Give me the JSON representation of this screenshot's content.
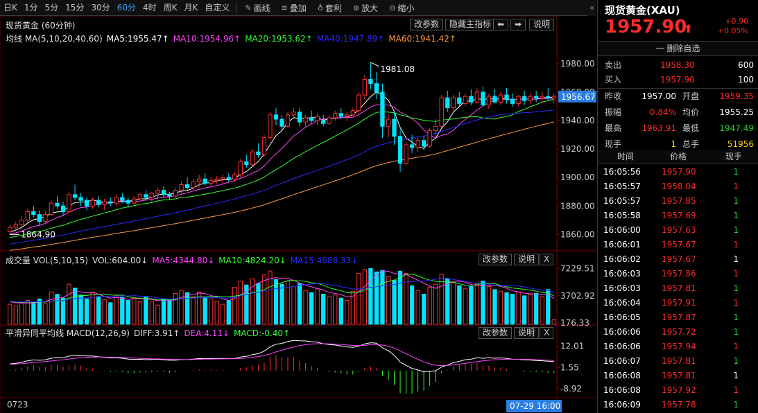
{
  "toolbar": {
    "periods": [
      "日K",
      "1分",
      "5分",
      "15分",
      "30分",
      "60分",
      "4时",
      "周K",
      "月K",
      "自定义"
    ],
    "active_period": "60分",
    "tools": [
      {
        "icon": "pencil-icon",
        "label": "画线"
      },
      {
        "icon": "layers-icon",
        "label": "叠加"
      },
      {
        "icon": "money-bag-icon",
        "label": "套利"
      },
      {
        "icon": "zoom-in-icon",
        "label": "放大"
      },
      {
        "icon": "zoom-out-icon",
        "label": "缩小"
      }
    ],
    "collapse": "«"
  },
  "main_panel": {
    "title": "现货黄金 (60分钟)",
    "buttons": {
      "params": "改参数",
      "hide": "隐藏主指标",
      "left": "⬅",
      "right": "➡",
      "explain": "说明"
    },
    "ma_legend": [
      {
        "text": "均线 MA(5,10,20,40,60)",
        "color": "#e0e0e0"
      },
      {
        "text": "MA5:1955.47↑",
        "color": "#ffffff"
      },
      {
        "text": "MA10:1954.96↑",
        "color": "#ff44ff"
      },
      {
        "text": "MA20:1953.62↑",
        "color": "#33ff33"
      },
      {
        "text": "MA40:1947.89↑",
        "color": "#2a2aff"
      },
      {
        "text": "MA60:1941.42↑",
        "color": "#ff9a3c"
      }
    ],
    "annot_high": "1981.08",
    "annot_low": "1864.90",
    "current_tag": "1956.67"
  },
  "vol_panel": {
    "legend": [
      {
        "text": "成交量 VOL(5,10,15)",
        "color": "#e0e0e0"
      },
      {
        "text": "VOL:604.00↓",
        "color": "#e0e0e0"
      },
      {
        "text": "MA5:4344.80↓",
        "color": "#ff44ff"
      },
      {
        "text": "MA10:4824.20↓",
        "color": "#33ff33"
      },
      {
        "text": "MA15:4688.33↓",
        "color": "#2a2aff"
      }
    ],
    "buttons": {
      "params": "改参数",
      "explain": "说明",
      "close": "X"
    }
  },
  "macd_panel": {
    "legend": [
      {
        "text": "平滑异同平均线 MACD(12,26,9)",
        "color": "#e0e0e0"
      },
      {
        "text": "DIFF:3.91↑",
        "color": "#e0e0e0"
      },
      {
        "text": "DEA:4.11↓",
        "color": "#ff44ff"
      },
      {
        "text": "MACD:-0.40↑",
        "color": "#33ff33"
      }
    ],
    "buttons": {
      "params": "改参数",
      "explain": "说明",
      "close": "X"
    }
  },
  "xaxis": {
    "left_label": "0723",
    "right_label": "07-29 16:00"
  },
  "chart_data": {
    "type": "candlestick",
    "price_axis": {
      "ticks": [
        1980,
        1960,
        1940,
        1920,
        1900,
        1880,
        1860
      ],
      "range": [
        1848,
        1996
      ]
    },
    "vol_axis": {
      "ticks": [
        7229.51,
        3702.92,
        176.33
      ],
      "range": [
        0,
        8000
      ]
    },
    "macd_axis": {
      "ticks": [
        12.01,
        1.55,
        -8.92
      ],
      "range": [
        -13,
        17
      ]
    },
    "candles": [
      [
        1862,
        1867,
        1860,
        1865,
        2600
      ],
      [
        1865,
        1869,
        1862,
        1867,
        2400
      ],
      [
        1867,
        1873,
        1864,
        1870,
        2800
      ],
      [
        1870,
        1878,
        1868,
        1876,
        3100
      ],
      [
        1876,
        1880,
        1872,
        1874,
        2900
      ],
      [
        1874,
        1877,
        1866,
        1869,
        3300
      ],
      [
        1869,
        1876,
        1867,
        1874,
        2700
      ],
      [
        1874,
        1884,
        1873,
        1882,
        4200
      ],
      [
        1882,
        1887,
        1878,
        1880,
        3900
      ],
      [
        1880,
        1883,
        1873,
        1876,
        3400
      ],
      [
        1876,
        1890,
        1875,
        1888,
        5200
      ],
      [
        1888,
        1895,
        1884,
        1886,
        4700
      ],
      [
        1886,
        1889,
        1880,
        1884,
        3800
      ],
      [
        1884,
        1886,
        1877,
        1880,
        3300
      ],
      [
        1880,
        1886,
        1878,
        1884,
        4100
      ],
      [
        1884,
        1887,
        1879,
        1881,
        3600
      ],
      [
        1881,
        1885,
        1877,
        1883,
        3200
      ],
      [
        1883,
        1886,
        1880,
        1882,
        2800
      ],
      [
        1882,
        1888,
        1880,
        1886,
        3700
      ],
      [
        1886,
        1889,
        1882,
        1884,
        3500
      ],
      [
        1884,
        1886,
        1879,
        1882,
        3100
      ],
      [
        1882,
        1887,
        1881,
        1885,
        3400
      ],
      [
        1885,
        1889,
        1884,
        1888,
        3000
      ],
      [
        1888,
        1891,
        1884,
        1886,
        3600
      ],
      [
        1886,
        1890,
        1883,
        1889,
        2900
      ],
      [
        1889,
        1893,
        1885,
        1891,
        2500
      ],
      [
        1891,
        1894,
        1886,
        1888,
        3300
      ],
      [
        1888,
        1890,
        1884,
        1887,
        3100
      ],
      [
        1887,
        1893,
        1886,
        1891,
        4000
      ],
      [
        1891,
        1897,
        1889,
        1895,
        4400
      ],
      [
        1895,
        1900,
        1891,
        1893,
        4100
      ],
      [
        1893,
        1899,
        1891,
        1897,
        3600
      ],
      [
        1897,
        1902,
        1893,
        1899,
        4200
      ],
      [
        1899,
        1903,
        1894,
        1896,
        3500
      ],
      [
        1896,
        1900,
        1893,
        1898,
        3300
      ],
      [
        1898,
        1901,
        1895,
        1899,
        3000
      ],
      [
        1899,
        1902,
        1896,
        1900,
        2600
      ],
      [
        1900,
        1903,
        1897,
        1899,
        3100
      ],
      [
        1899,
        1904,
        1897,
        1902,
        4800
      ],
      [
        1902,
        1913,
        1900,
        1911,
        5600
      ],
      [
        1911,
        1916,
        1907,
        1909,
        5100
      ],
      [
        1909,
        1920,
        1908,
        1918,
        5900
      ],
      [
        1918,
        1924,
        1914,
        1916,
        5300
      ],
      [
        1916,
        1930,
        1915,
        1928,
        6400
      ],
      [
        1928,
        1946,
        1926,
        1944,
        6900
      ],
      [
        1944,
        1949,
        1937,
        1941,
        5800
      ],
      [
        1941,
        1944,
        1933,
        1936,
        5200
      ],
      [
        1936,
        1946,
        1935,
        1944,
        5600
      ],
      [
        1944,
        1949,
        1941,
        1946,
        4900
      ],
      [
        1946,
        1949,
        1936,
        1939,
        5300
      ],
      [
        1939,
        1944,
        1936,
        1942,
        4400
      ],
      [
        1942,
        1947,
        1938,
        1940,
        4100
      ],
      [
        1940,
        1945,
        1937,
        1943,
        4600
      ],
      [
        1940,
        1944,
        1936,
        1938,
        3900
      ],
      [
        1938,
        1944,
        1937,
        1942,
        3600
      ],
      [
        1942,
        1947,
        1940,
        1945,
        3800
      ],
      [
        1945,
        1949,
        1941,
        1943,
        3400
      ],
      [
        1943,
        1946,
        1940,
        1944,
        3100
      ],
      [
        1944,
        1949,
        1943,
        1947,
        4300
      ],
      [
        1947,
        1960,
        1946,
        1958,
        6600
      ],
      [
        1958,
        1972,
        1955,
        1969,
        7100
      ],
      [
        1969,
        1981,
        1962,
        1966,
        7229
      ],
      [
        1966,
        1974,
        1955,
        1960,
        6800
      ],
      [
        1960,
        1966,
        1928,
        1936,
        7000
      ],
      [
        1936,
        1945,
        1928,
        1941,
        6200
      ],
      [
        1941,
        1946,
        1923,
        1929,
        5700
      ],
      [
        1929,
        1934,
        1904,
        1910,
        6900
      ],
      [
        1910,
        1925,
        1908,
        1923,
        6600
      ],
      [
        1923,
        1930,
        1917,
        1921,
        5000
      ],
      [
        1921,
        1928,
        1918,
        1926,
        4400
      ],
      [
        1926,
        1929,
        1919,
        1922,
        3900
      ],
      [
        1922,
        1935,
        1921,
        1933,
        4800
      ],
      [
        1933,
        1941,
        1928,
        1936,
        5200
      ],
      [
        1936,
        1958,
        1935,
        1956,
        6500
      ],
      [
        1956,
        1961,
        1946,
        1949,
        5900
      ],
      [
        1949,
        1958,
        1947,
        1956,
        5400
      ],
      [
        1956,
        1960,
        1950,
        1952,
        5000
      ],
      [
        1952,
        1959,
        1950,
        1957,
        4600
      ],
      [
        1957,
        1962,
        1951,
        1953,
        4900
      ],
      [
        1953,
        1963,
        1952,
        1960,
        5300
      ],
      [
        1960,
        1964,
        1950,
        1951,
        5600
      ],
      [
        1951,
        1959,
        1948,
        1957,
        4900
      ],
      [
        1957,
        1962,
        1952,
        1953,
        4500
      ],
      [
        1953,
        1960,
        1951,
        1958,
        4300
      ],
      [
        1958,
        1963,
        1952,
        1955,
        4100
      ],
      [
        1955,
        1959,
        1950,
        1952,
        3900
      ],
      [
        1952,
        1958,
        1950,
        1957,
        4200
      ],
      [
        1957,
        1961,
        1951,
        1954,
        3700
      ],
      [
        1954,
        1959,
        1952,
        1957,
        3900
      ],
      [
        1957,
        1961,
        1953,
        1956,
        4000
      ],
      [
        1956,
        1960,
        1952,
        1957,
        3600
      ],
      [
        1957,
        1963,
        1954,
        1956,
        4500
      ],
      [
        1956,
        1959,
        1952,
        1957,
        604
      ]
    ]
  }
}
